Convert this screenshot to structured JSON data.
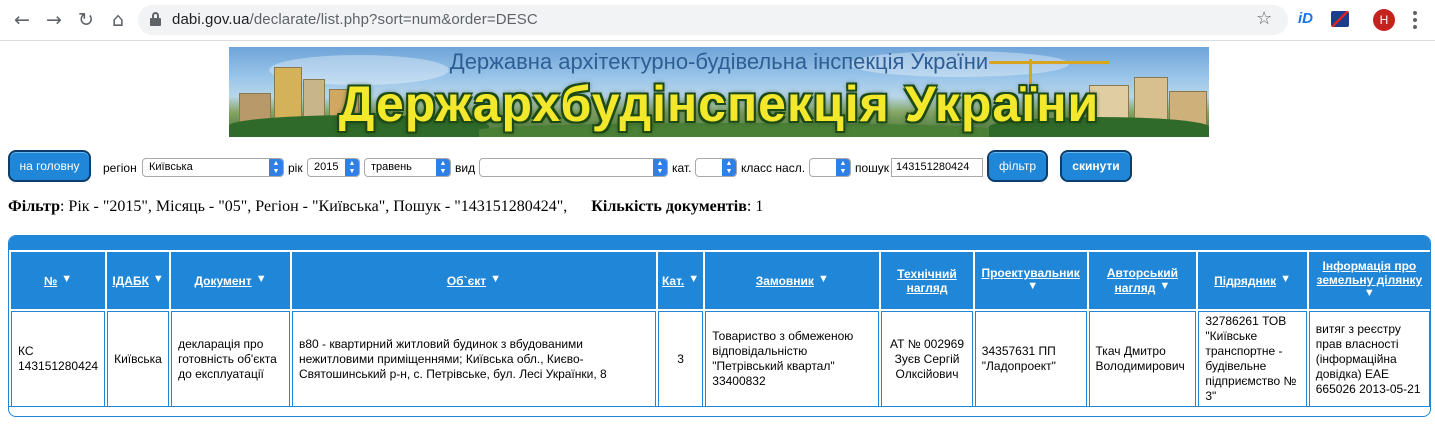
{
  "browser": {
    "url_host": "dabi.gov.ua",
    "url_path": "/declarate/list.php?sort=num&order=DESC",
    "ext_label": "iD",
    "avatar_letter": "H"
  },
  "banner": {
    "subtitle": "Державна архітектурно-будівельна інспекція України",
    "title": "Держархбудінспекція України"
  },
  "filters": {
    "home_button": "на головну",
    "region_label": "регіон",
    "region_value": "Київська",
    "year_label": "рік",
    "year_value": "2015",
    "month_value": "травень",
    "type_label": "вид",
    "type_value": "",
    "cat_label": "кат.",
    "cat_value": "",
    "class_label": "класс насл.",
    "class_value": "",
    "search_label": "пошук",
    "search_value": "143151280424",
    "filter_button": "фільтр",
    "reset_button": "скинути"
  },
  "summary": {
    "filter_label": "Фільтр",
    "filter_text": ": Рік - \"2015\", Місяць - \"05\", Регіон - \"Київська\", Пошук - \"143151280424\",",
    "count_label": "Кількість документів",
    "count_value": ": 1"
  },
  "table": {
    "headers": [
      {
        "line1": "№",
        "line2": ""
      },
      {
        "line1": "ІДАБК",
        "line2": ""
      },
      {
        "line1": "Документ",
        "line2": ""
      },
      {
        "line1": "Об`єкт",
        "line2": ""
      },
      {
        "line1": "Кат.",
        "line2": ""
      },
      {
        "line1": "Замовник",
        "line2": ""
      },
      {
        "line1": "Технічний",
        "line2": "нагляд"
      },
      {
        "line1": "Проектувальник",
        "line2": ""
      },
      {
        "line1": "Авторський",
        "line2": "нагляд"
      },
      {
        "line1": "Підрядник",
        "line2": ""
      },
      {
        "line1": "Інформація про",
        "line2": "земельну ділянку"
      }
    ],
    "row": {
      "num": "КС 143151280424",
      "idabk": "Київська",
      "document": "декларація про готовність об'єкта до експлуатації",
      "object": "в80 - квартирний житловий будинок з вбудованими нежитловими приміщеннями; Київська обл., Києво-Святошинський р-н, с. Петрівське, бул. Лесі Українки, 8",
      "cat": "3",
      "customer": "Товариство з обмеженою відповідальністю \"Петрівський квартал\" 33400832",
      "tech": "АТ № 002969 Зуєв Сергій Олксійович",
      "designer": "34357631 ПП \"Ладопроект\"",
      "author": "Ткач Дмитро Володимирович",
      "contractor": "32786261 ТОВ \"Київське транспортне - будівельне підприємство № 3\"",
      "land": "витяг з реєстру прав власності (інформаційна довідка) ЕАЕ 665026 2013-05-21"
    }
  }
}
